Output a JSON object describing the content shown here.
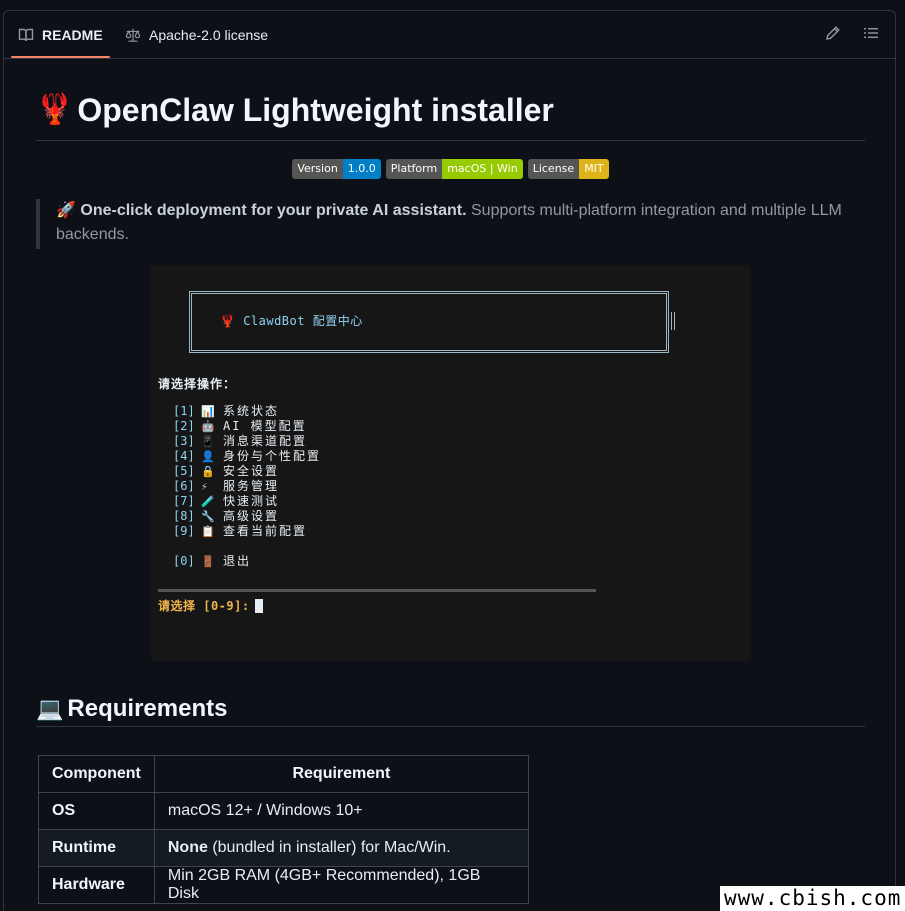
{
  "tabs": {
    "readme": "README",
    "license": "Apache-2.0 license"
  },
  "header": {
    "emoji": "🦞",
    "title": "OpenClaw Lightweight installer"
  },
  "badges": [
    {
      "label": "Version",
      "value": "1.0.0",
      "color": "#007ec6"
    },
    {
      "label": "Platform",
      "value": "macOS | Win",
      "color": "#97ca00"
    },
    {
      "label": "License",
      "value": "MIT",
      "color": "#dfb317"
    }
  ],
  "quote": {
    "emoji": "🚀",
    "bold": "One-click deployment for your private AI assistant.",
    "rest": " Supports multi-platform integration and multiple LLM backends."
  },
  "terminal": {
    "title_icon": "🦞",
    "title": "ClawdBot 配置中心",
    "prompt_label": "请选择操作：",
    "menu": [
      {
        "num": "[1]",
        "icon": "📊",
        "label": "系统状态"
      },
      {
        "num": "[2]",
        "icon": "🤖",
        "label": "AI 模型配置"
      },
      {
        "num": "[3]",
        "icon": "📱",
        "label": "消息渠道配置"
      },
      {
        "num": "[4]",
        "icon": "👤",
        "label": "身份与个性配置"
      },
      {
        "num": "[5]",
        "icon": "🔒",
        "label": "安全设置"
      },
      {
        "num": "[6]",
        "icon": "⚡",
        "label": "服务管理"
      },
      {
        "num": "[7]",
        "icon": "🧪",
        "label": "快速测试"
      },
      {
        "num": "[8]",
        "icon": "🔧",
        "label": "高级设置"
      },
      {
        "num": "[9]",
        "icon": "📋",
        "label": "查看当前配置"
      }
    ],
    "exit": {
      "num": "[0]",
      "icon": "🚪",
      "label": "退出"
    },
    "input_prompt": "请选择 [0-9]:"
  },
  "requirements": {
    "emoji": "💻",
    "title": "Requirements",
    "headers": [
      "Component",
      "Requirement"
    ],
    "rows": [
      {
        "component": "OS",
        "bold": "",
        "requirement": "macOS 12+ / Windows 10+"
      },
      {
        "component": "Runtime",
        "bold": "None",
        "requirement": " (bundled in installer) for Mac/Win."
      },
      {
        "component": "Hardware",
        "bold": "",
        "requirement": "Min 2GB RAM (4GB+ Recommended), 1GB Disk"
      }
    ]
  },
  "watermark": "www.cbish.com",
  "colors": {
    "background": "#0d1117",
    "border": "#30363d",
    "accent_underline": "#f78166",
    "terminal_bg": "#161616",
    "terminal_cyan": "#8fd3f1",
    "terminal_prompt": "#f0b64a"
  }
}
